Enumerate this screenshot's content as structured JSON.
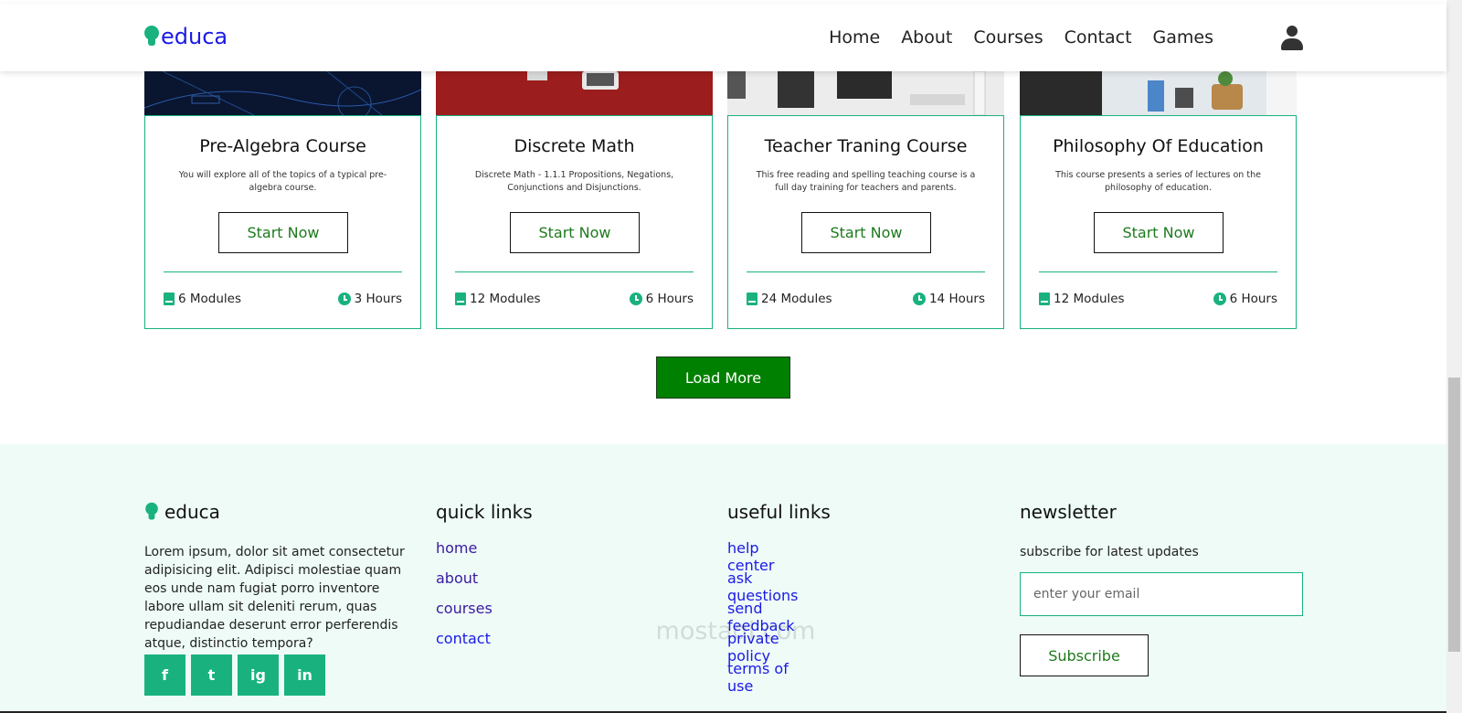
{
  "header": {
    "logo_text": "educa",
    "nav": [
      "Home",
      "About",
      "Courses",
      "Contact",
      "Games"
    ]
  },
  "courses": [
    {
      "title": "Pre-Algebra Course",
      "description": "You will explore all of the topics of a typical pre-algebra course.",
      "button": "Start Now",
      "modules": "6 Modules",
      "hours": "3 Hours"
    },
    {
      "title": "Discrete Math",
      "description": "Discrete Math - 1.1.1 Propositions, Negations, Conjunctions and Disjunctions.",
      "button": "Start Now",
      "modules": "12 Modules",
      "hours": "6 Hours"
    },
    {
      "title": "Teacher Traning Course",
      "description": "This free reading and spelling teaching course is a full day training for teachers and parents.",
      "button": "Start Now",
      "modules": "24 Modules",
      "hours": "14 Hours"
    },
    {
      "title": "Philosophy Of Education",
      "description": "This course presents a series of lectures on the philosophy of education.",
      "button": "Start Now",
      "modules": "12 Modules",
      "hours": "6 Hours"
    }
  ],
  "load_more": "Load More",
  "footer": {
    "brand": "educa",
    "description": "Lorem ipsum, dolor sit amet consectetur adipisicing elit. Adipisci molestiae quam eos unde nam fugiat porro inventore labore ullam sit deleniti rerum, quas repudiandae deserunt error perferendis atque, distinctio tempora?",
    "social": [
      "f",
      "t",
      "ig",
      "in"
    ],
    "quick_links_title": "quick links",
    "quick_links": [
      "home",
      "about",
      "courses",
      "contact"
    ],
    "useful_links_title": "useful links",
    "useful_links": [
      "help center",
      "ask questions",
      "send feedback",
      "private policy",
      "terms of use"
    ],
    "newsletter_title": "newsletter",
    "newsletter_sub": "subscribe for latest updates",
    "email_placeholder": "enter your email",
    "subscribe_label": "Subscribe"
  },
  "watermark": "mostaql.com",
  "colors": {
    "accent": "#19b27e",
    "load_more_bg": "#008000",
    "footer_bg": "#eefbf7",
    "logo": "#1a1ae6"
  }
}
